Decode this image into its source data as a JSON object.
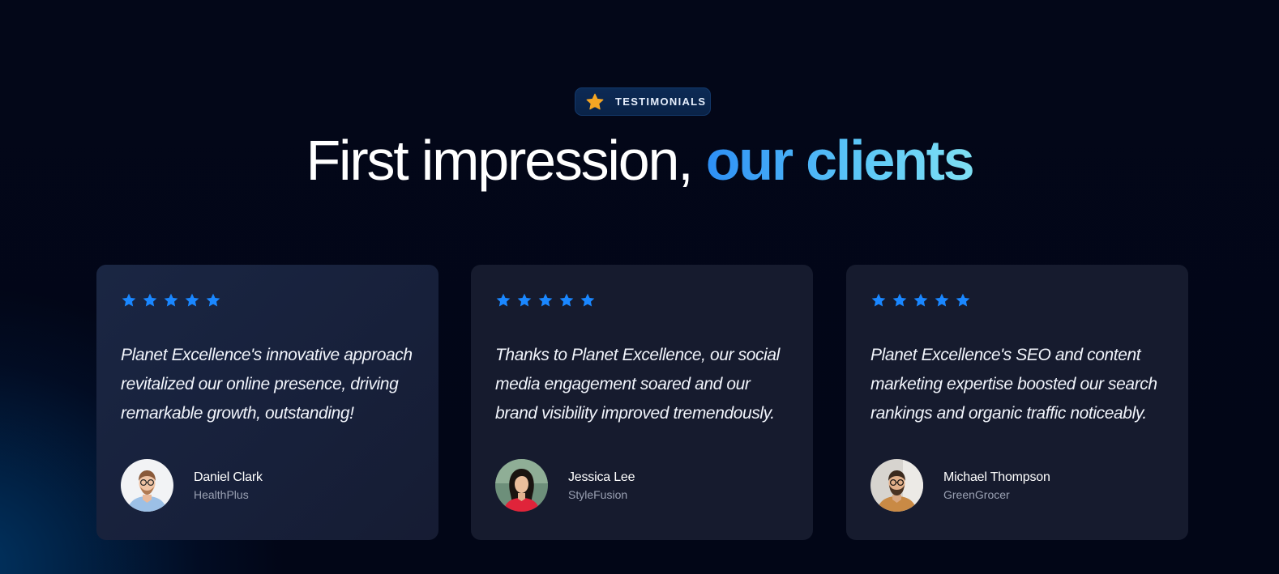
{
  "badge": {
    "label": "TESTIMONIALS",
    "icon": "star-icon",
    "icon_color": "#f5a623"
  },
  "headline": {
    "part1": "First impression, ",
    "part2": "our clients",
    "accent_from": "#2d8ff5",
    "accent_to": "#7fe0f4"
  },
  "colors": {
    "star": "#1a87ff",
    "card_bg": "#161b2e"
  },
  "testimonials": [
    {
      "rating": 5,
      "quote": "Planet Excellence's innovative approach revitalized our online presence, driving remarkable growth, outstanding!",
      "name": "Daniel Clark",
      "company": "HealthPlus",
      "avatar": "avatar-man-glasses"
    },
    {
      "rating": 5,
      "quote": "Thanks to Planet Excellence, our social media engagement soared and our brand visibility improved tremendously.",
      "name": "Jessica Lee",
      "company": "StyleFusion",
      "avatar": "avatar-woman-red"
    },
    {
      "rating": 5,
      "quote": "Planet Excellence's SEO and content marketing expertise boosted our search rankings and organic traffic noticeably.",
      "name": "Michael Thompson",
      "company": "GreenGrocer",
      "avatar": "avatar-man-beard"
    }
  ]
}
